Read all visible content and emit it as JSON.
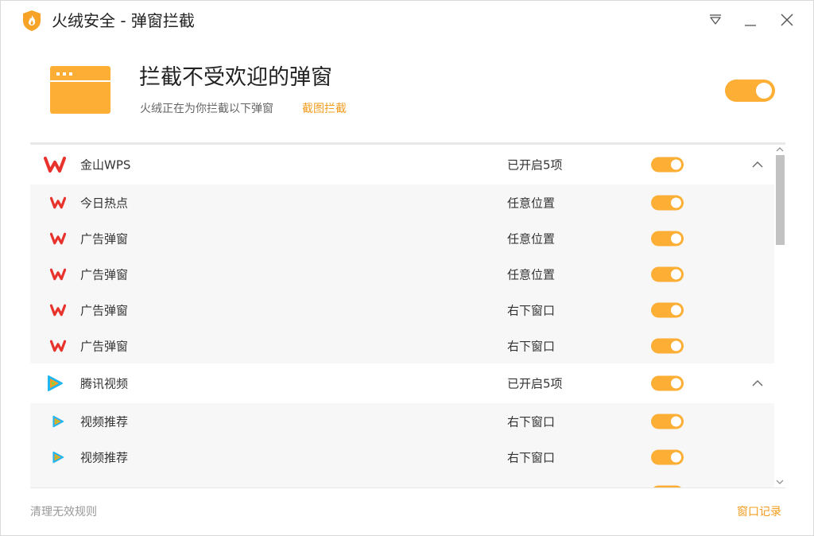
{
  "window": {
    "title": "火绒安全 - 弹窗拦截"
  },
  "header": {
    "title": "拦截不受欢迎的弹窗",
    "description": "火绒正在为你拦截以下弹窗",
    "link": "截图拦截",
    "master_toggle": "on"
  },
  "groups": [
    {
      "name": "金山WPS",
      "status": "已开启5项",
      "icon": "wps-icon",
      "items": [
        {
          "name": "今日热点",
          "position": "任意位置"
        },
        {
          "name": "广告弹窗",
          "position": "任意位置"
        },
        {
          "name": "广告弹窗",
          "position": "任意位置"
        },
        {
          "name": "广告弹窗",
          "position": "右下窗口"
        },
        {
          "name": "广告弹窗",
          "position": "右下窗口"
        }
      ]
    },
    {
      "name": "腾讯视频",
      "status": "已开启5项",
      "icon": "tencent-video-icon",
      "items": [
        {
          "name": "视频推荐",
          "position": "右下窗口"
        },
        {
          "name": "视频推荐",
          "position": "右下窗口"
        }
      ]
    }
  ],
  "footer": {
    "left": "清理无效规则",
    "right": "窗口记录"
  },
  "colors": {
    "accent": "#fdae35",
    "link": "#f29c1f",
    "wps_red": "#e8322c"
  }
}
